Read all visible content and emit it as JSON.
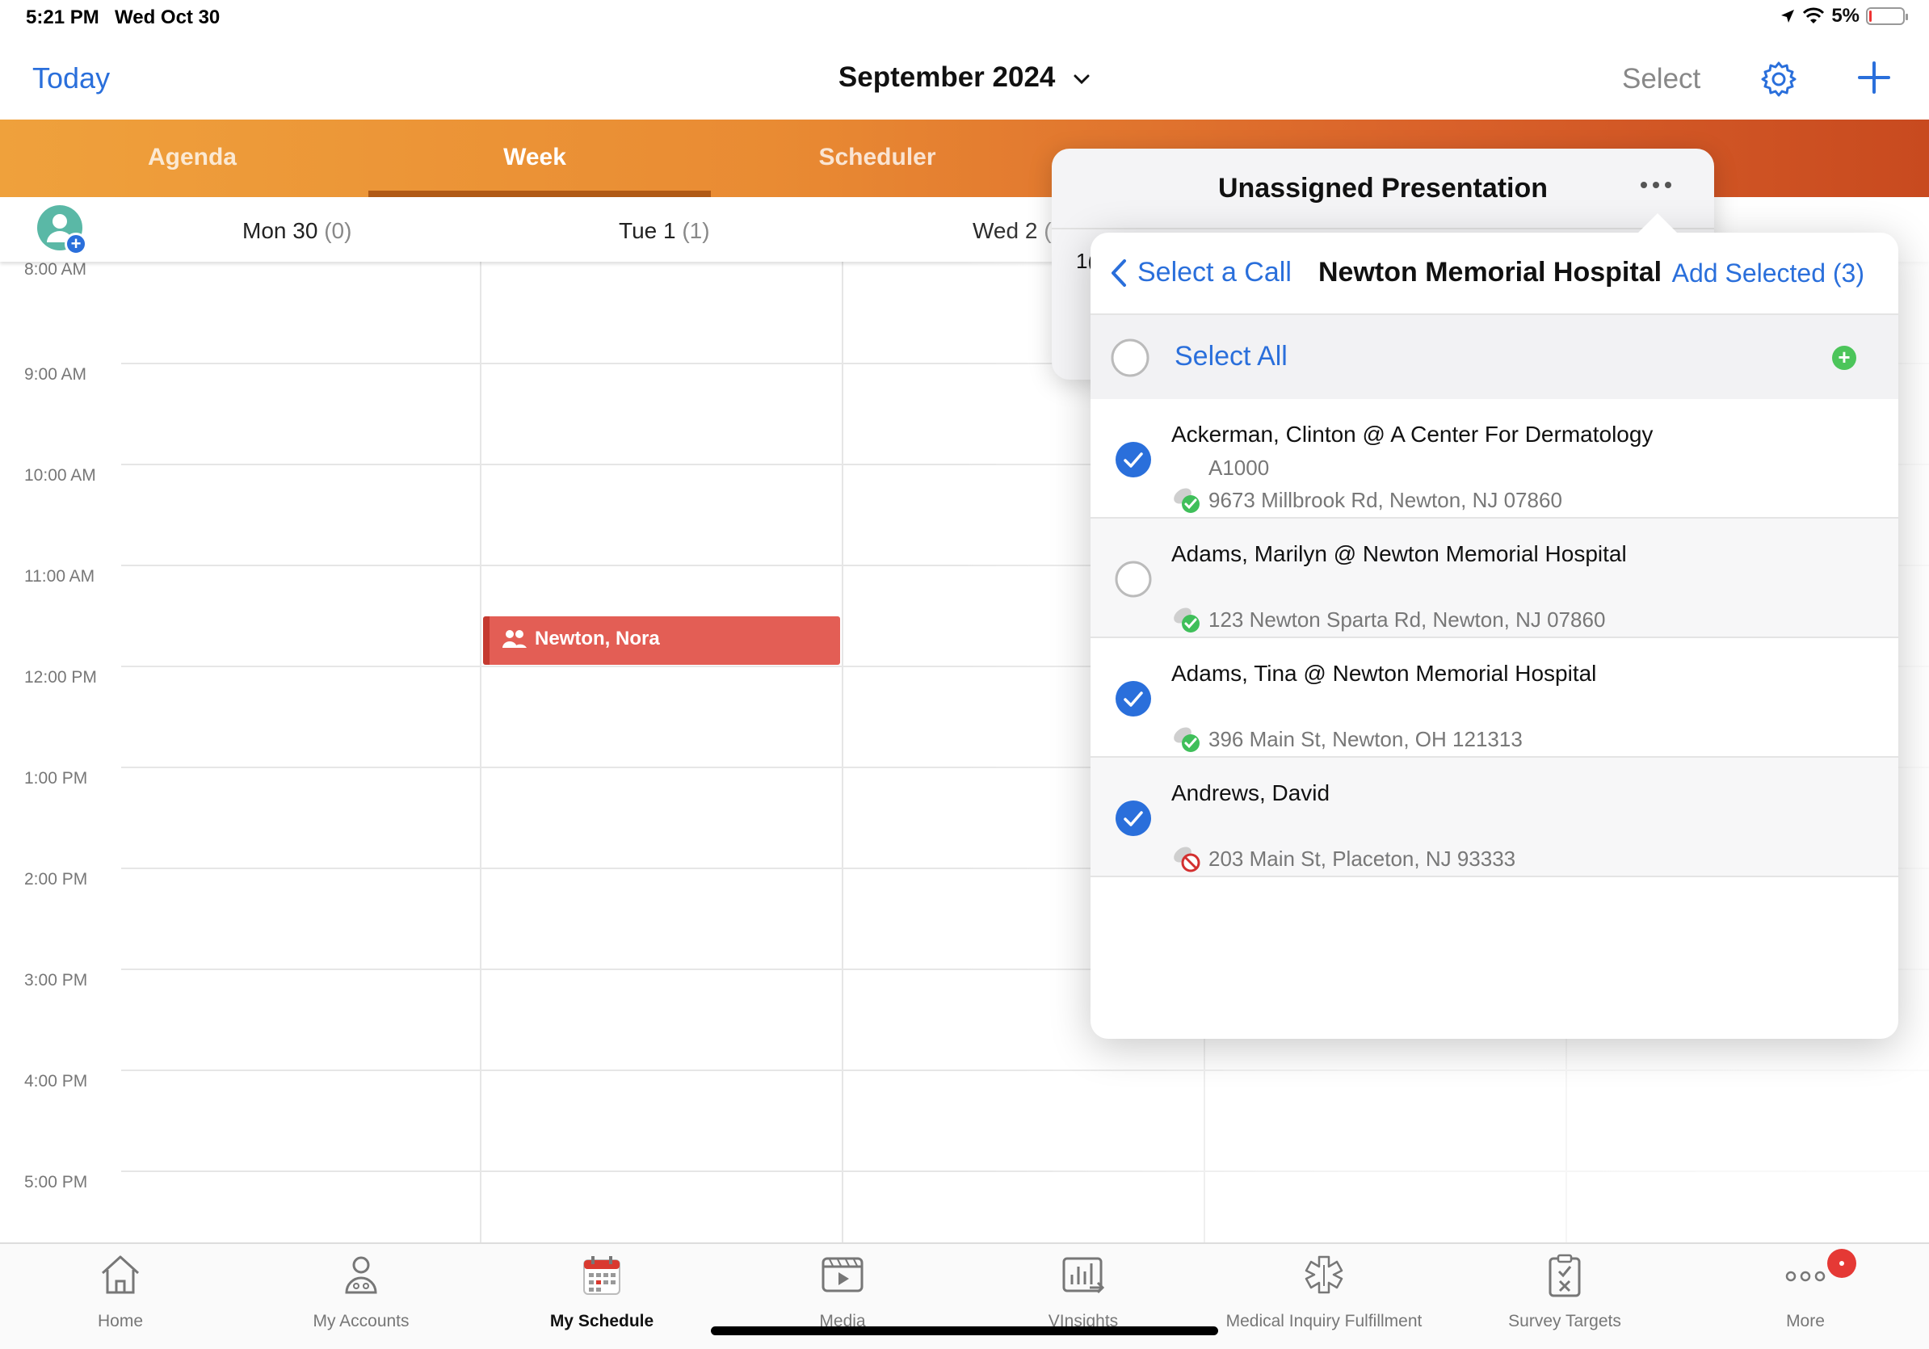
{
  "status_bar": {
    "time": "5:21 PM",
    "date": "Wed Oct 30",
    "battery": "5%"
  },
  "nav": {
    "today": "Today",
    "month": "September 2024",
    "select": "Select"
  },
  "tabs": [
    "Agenda",
    "Week",
    "Scheduler"
  ],
  "days": [
    {
      "label": "Mon 30",
      "count": "(0)"
    },
    {
      "label": "Tue 1",
      "count": "(1)"
    },
    {
      "label": "Wed 2",
      "count": "("
    }
  ],
  "times": [
    "8:00 AM",
    "9:00 AM",
    "10:00 AM",
    "11:00 AM",
    "12:00 PM",
    "1:00 PM",
    "2:00 PM",
    "3:00 PM",
    "4:00 PM",
    "5:00 PM"
  ],
  "event": {
    "title": "Newton, Nora"
  },
  "popover": {
    "title": "Unassigned Presentation",
    "stub": "1("
  },
  "panel": {
    "back": "Select a Call",
    "title": "Newton Memorial Hospital",
    "add_selected": "Add Selected (3)",
    "select_all": "Select All",
    "rows": [
      {
        "name": "Ackerman, Clinton @ A Center For Dermatology",
        "sub": "A1000",
        "address": "9673 Millbrook Rd, Newton, NJ 07860",
        "checked": true,
        "status": "ok"
      },
      {
        "name": "Adams, Marilyn @ Newton Memorial Hospital",
        "sub": "",
        "address": "123 Newton Sparta Rd, Newton, NJ 07860",
        "checked": false,
        "status": "ok"
      },
      {
        "name": "Adams, Tina @ Newton Memorial Hospital",
        "sub": "",
        "address": "396 Main St, Newton, OH 121313",
        "checked": true,
        "status": "ok"
      },
      {
        "name": "Andrews, David",
        "sub": "",
        "address": "203 Main St, Placeton, NJ 93333",
        "checked": true,
        "status": "blocked"
      }
    ]
  },
  "bottom_tabs": [
    {
      "label": "Home",
      "icon": "home-icon"
    },
    {
      "label": "My Accounts",
      "icon": "person-icon"
    },
    {
      "label": "My Schedule",
      "icon": "calendar-icon"
    },
    {
      "label": "Media",
      "icon": "media-icon"
    },
    {
      "label": "VInsights",
      "icon": "chart-icon"
    },
    {
      "label": "Medical Inquiry Fulfillment",
      "icon": "medical-icon"
    },
    {
      "label": "Survey Targets",
      "icon": "clipboard-icon"
    },
    {
      "label": "More",
      "icon": "more-icon"
    }
  ],
  "colors": {
    "accent": "#2a6fdb",
    "event": "#e35e55",
    "tab_start": "#efa13c",
    "tab_end": "#c84a1f"
  }
}
